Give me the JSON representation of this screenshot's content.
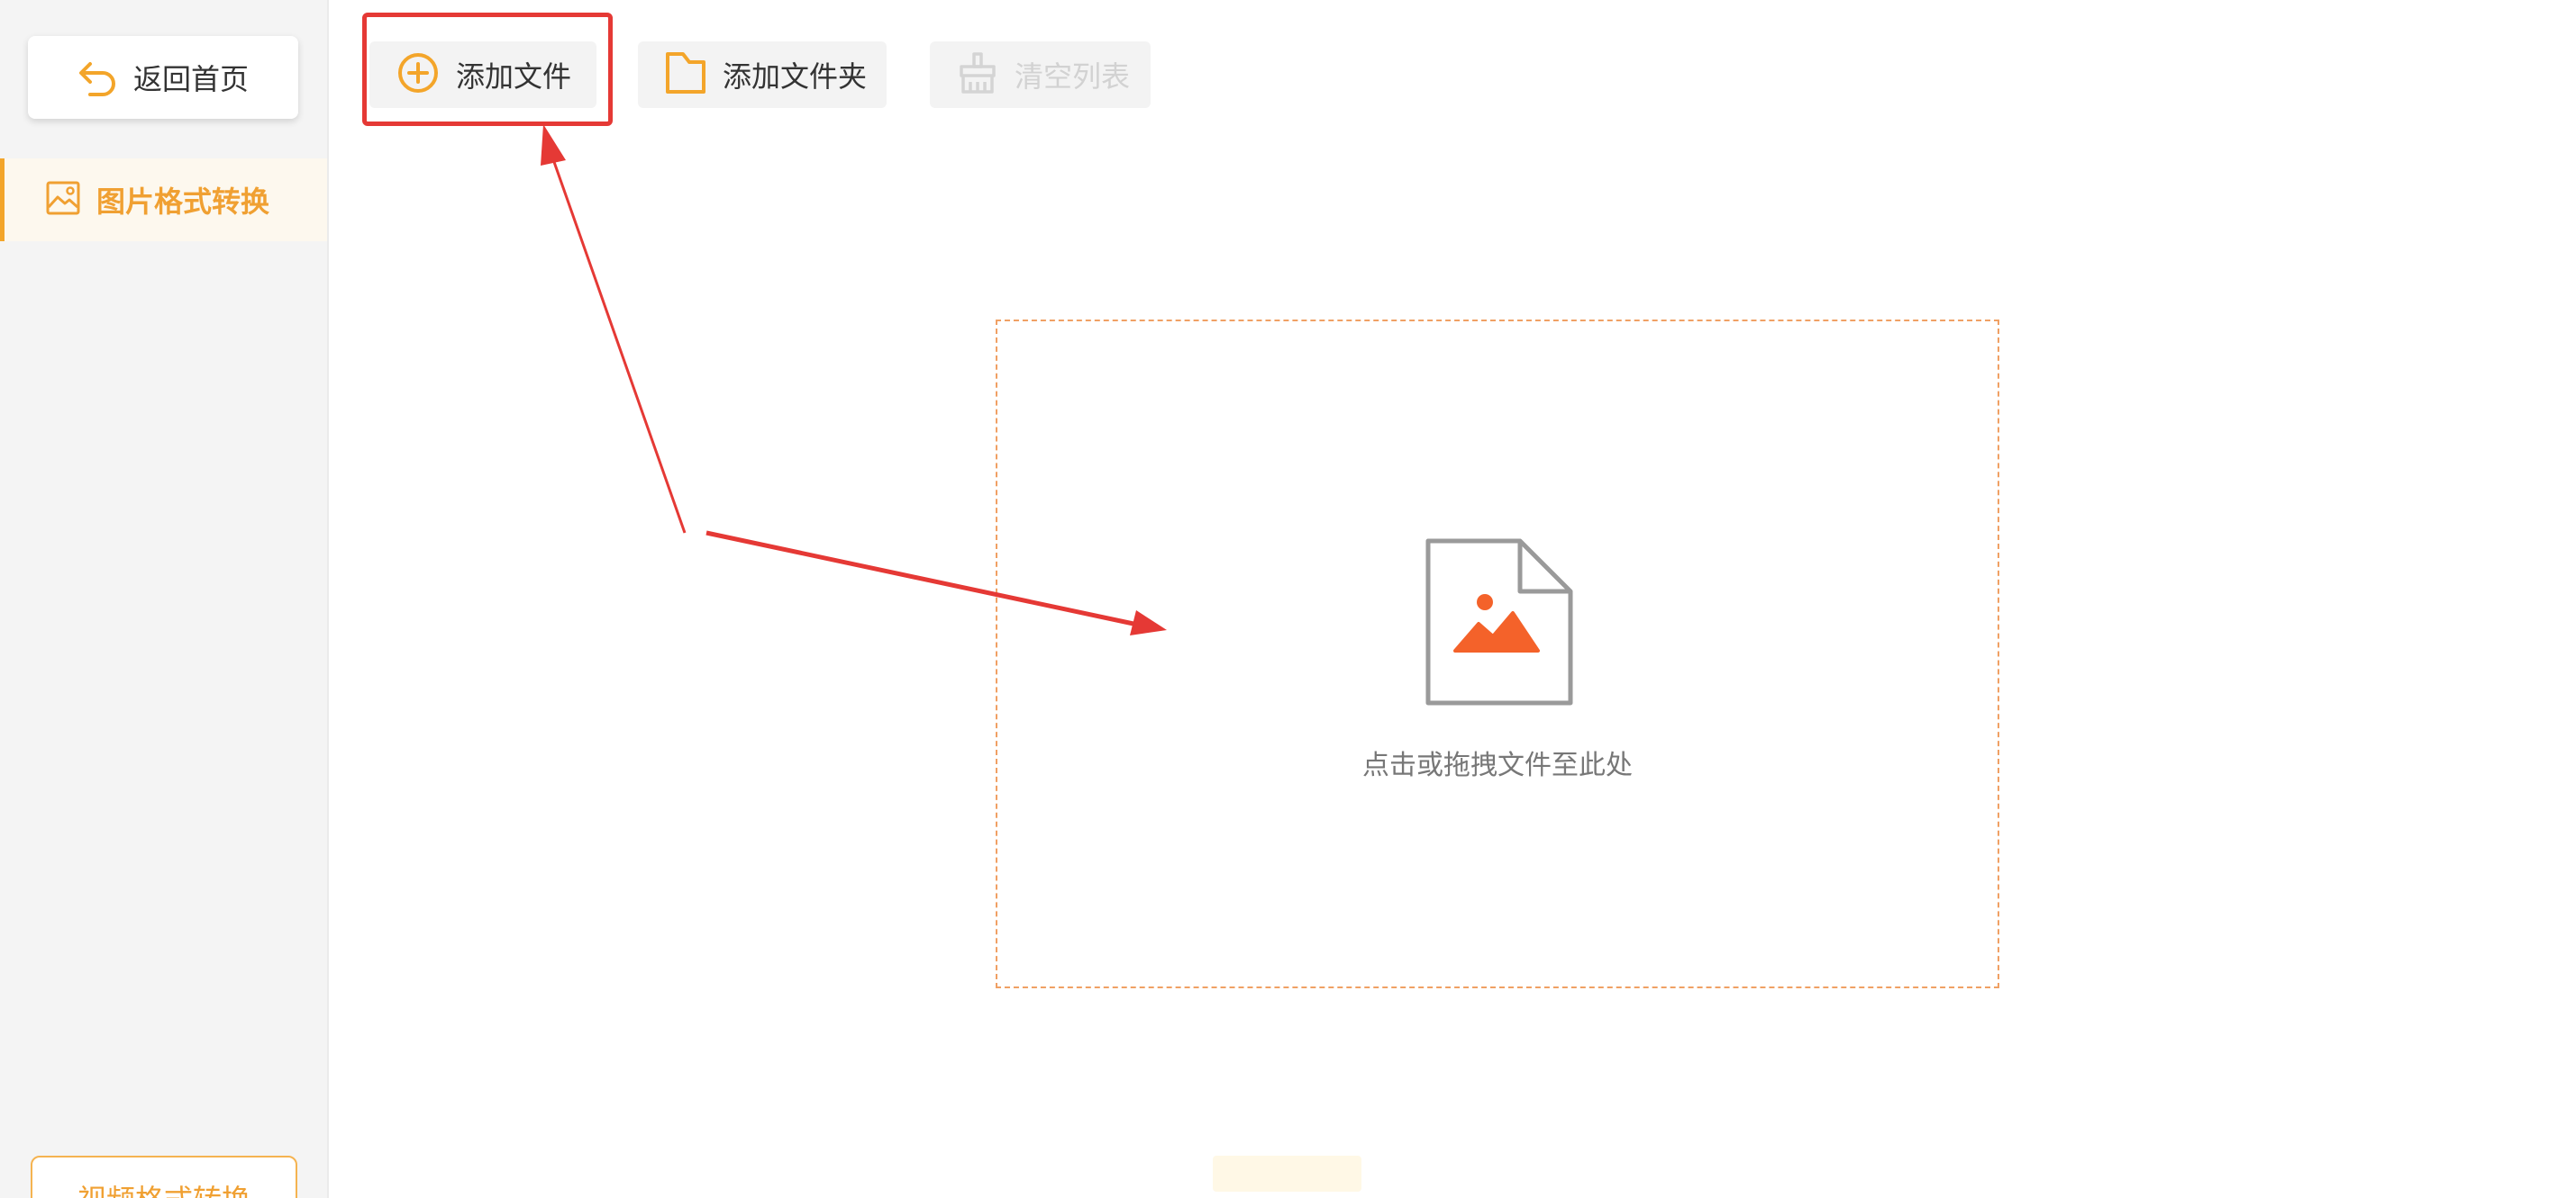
{
  "sidebar": {
    "back_label": "返回首页",
    "nav_items": [
      {
        "label": "图片格式转换",
        "active": true
      }
    ],
    "bottom_button_label": "视频格式转换"
  },
  "toolbar": {
    "add_file_label": "添加文件",
    "add_folder_label": "添加文件夹",
    "clear_list_label": "清空列表"
  },
  "drop_zone": {
    "hint": "点击或拖拽文件至此处"
  },
  "colors": {
    "accent": "#f3a52a",
    "annotation_red": "#e53935",
    "image_icon_orange": "#f4622a",
    "dashed_border": "#f0a064"
  }
}
